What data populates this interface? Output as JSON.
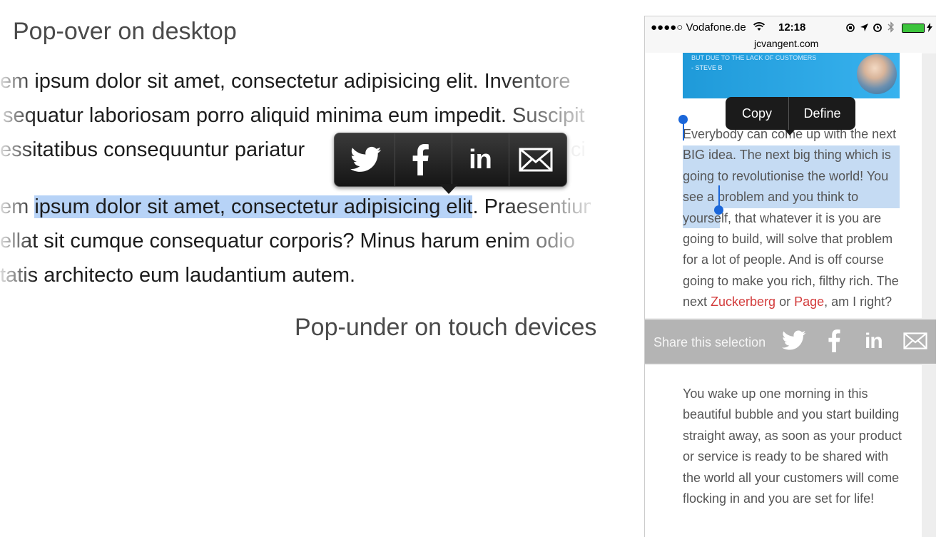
{
  "desktop": {
    "title": "Pop-over on desktop",
    "lines": [
      "em ipsum dolor sit amet, consectetur adipisicing elit. Inventore",
      "sequatur laboriosam porro aliquid minima eum impedit. Suscipit",
      "essitatibus consequuntur pariatur",
      "ci"
    ],
    "line4_pre": "em ",
    "line4_sel": "ipsum dolor sit amet, consectetur adipisicing elit",
    "line4_post": ". Praesentium",
    "line5": "ellat sit cumque consequatur corporis? Minus harum enim odio",
    "line6": "tatis architecto eum laudantium autem.",
    "popover_items": [
      "twitter-icon",
      "facebook-icon",
      "linkedin-icon",
      "email-icon"
    ],
    "caption": "Pop-under on touch devices"
  },
  "phone": {
    "status": {
      "carrier": "●●●●○ Vodafone.de",
      "time": "12:18",
      "url": "jcvangent.com"
    },
    "banner": {
      "line1": "BUT DUE TO THE LACK OF CUSTOMERS",
      "line2": "- STEVE B"
    },
    "callout": {
      "copy": "Copy",
      "define": "Define"
    },
    "para1_sel": "Everybody can come up with the next BIG idea. The next big thing which is going to revolutionise the world!",
    "para1_rest": " You see a problem and you think to yourself, that whatever it is you are going to build, will solve that problem for a lot of people. And is off course going to make you rich, filthy rich. The next ",
    "link1": "Zuckerberg",
    "para1_mid": " or ",
    "link2": "Page",
    "para1_end": ", am I right?",
    "share_label": "Share this selection",
    "para2": "You wake up one morning in this beautiful bubble and you start building straight away, as soon as your product or service is ready to be shared with the world all your customers will come flocking in and you are set for life!",
    "colors": {
      "link": "#d33b3b",
      "selection": "#c5dbf3",
      "handle": "#1a66d9",
      "battery": "#3cc43c"
    }
  }
}
